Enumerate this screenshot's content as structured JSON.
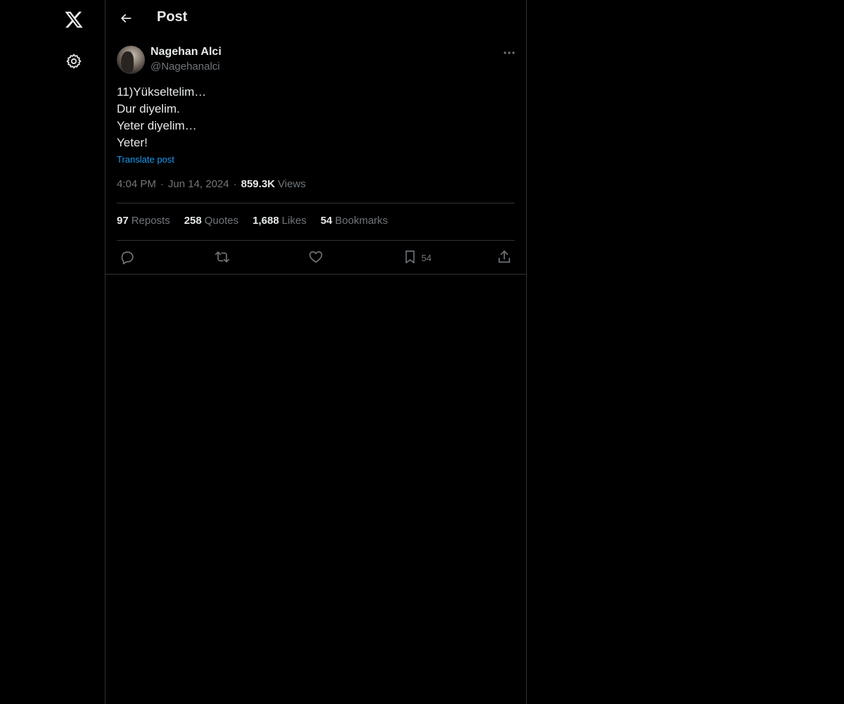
{
  "nav": {
    "logo_icon": "x-logo-icon",
    "settings_icon": "gear-icon"
  },
  "header": {
    "back_icon": "arrow-left-icon",
    "title": "Post"
  },
  "post": {
    "author_name": "Nagehan Alci",
    "author_handle": "@Nagehanalci",
    "lines": [
      "11)Yükseltelim…",
      "Dur diyelim.",
      "Yeter diyelim…",
      "Yeter!"
    ],
    "translate_label": "Translate post",
    "time": "4:04 PM",
    "date": "Jun 14, 2024",
    "separator": "·",
    "views_count": "859.3K",
    "views_label": "Views"
  },
  "stats": [
    {
      "count": "97",
      "label": "Reposts"
    },
    {
      "count": "258",
      "label": "Quotes"
    },
    {
      "count": "1,688",
      "label": "Likes"
    },
    {
      "count": "54",
      "label": "Bookmarks"
    }
  ],
  "actions": {
    "bookmark_count": "54"
  },
  "colors": {
    "background": "#000000",
    "text_primary": "#e7e9ea",
    "text_secondary": "#71767b",
    "accent_link": "#1d9bf0",
    "border": "#2f3336"
  }
}
